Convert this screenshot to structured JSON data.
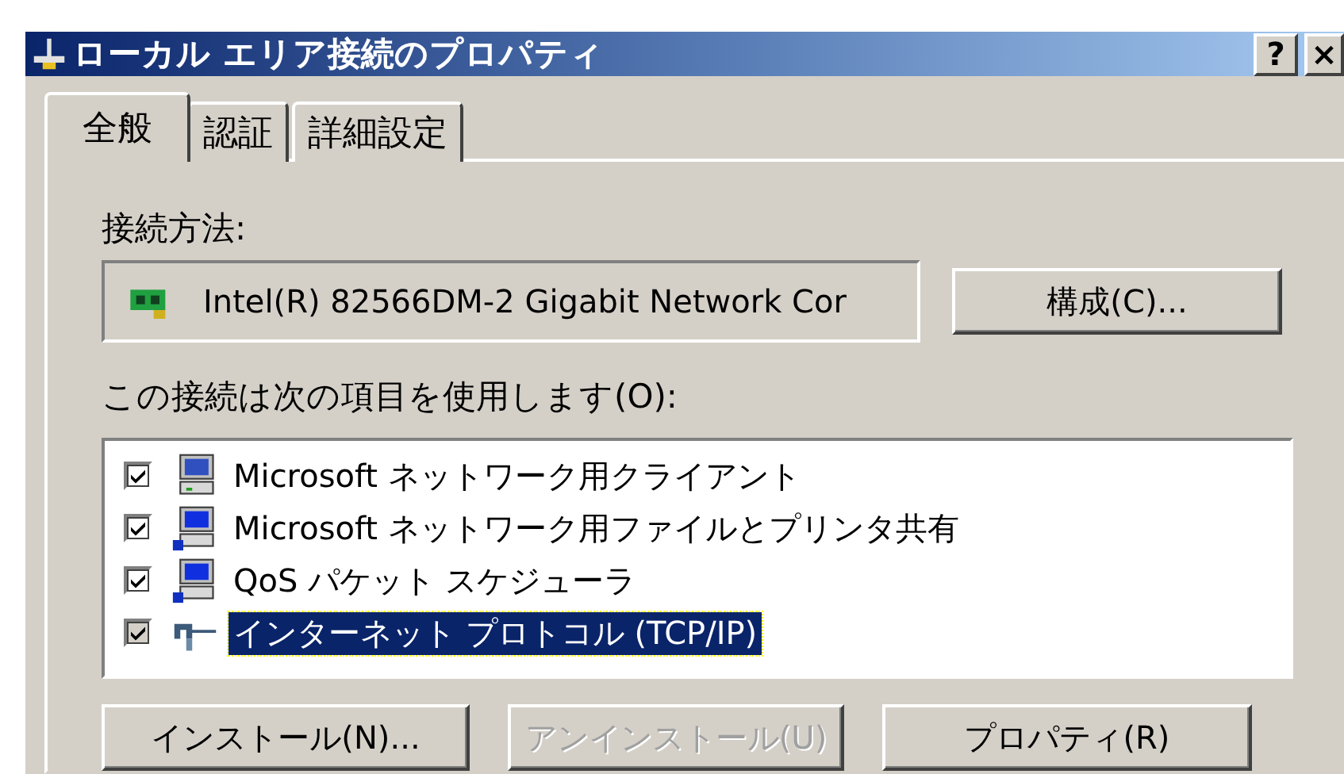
{
  "window": {
    "title": "ローカル エリア接続のプロパティ",
    "title_buttons": [
      "?",
      "×"
    ]
  },
  "tabs": [
    {
      "label": "全般",
      "selected": true
    },
    {
      "label": "認証",
      "selected": false
    },
    {
      "label": "詳細設定",
      "selected": false
    }
  ],
  "connect_using": {
    "label": "接続方法:",
    "adapter": "Intel(R) 82566DM-2 Gigabit Network Cor",
    "configure_button": "構成(C)..."
  },
  "components": {
    "label": "この接続は次の項目を使用します(O):",
    "items": [
      {
        "kind": "client",
        "label": "Microsoft ネットワーク用クライアント",
        "checked": true,
        "selected": false
      },
      {
        "kind": "service",
        "label": "Microsoft ネットワーク用ファイルとプリンタ共有",
        "checked": true,
        "selected": false
      },
      {
        "kind": "service",
        "label": "QoS パケット スケジューラ",
        "checked": true,
        "selected": false
      },
      {
        "kind": "protocol",
        "label": "インターネット プロトコル (TCP/IP)",
        "checked": true,
        "selected": true
      }
    ]
  },
  "buttons": [
    {
      "label": "インストール(N)...",
      "disabled": false
    },
    {
      "label": "アンインストール(U)",
      "disabled": true
    },
    {
      "label": "プロパティ(R)",
      "disabled": false
    }
  ]
}
